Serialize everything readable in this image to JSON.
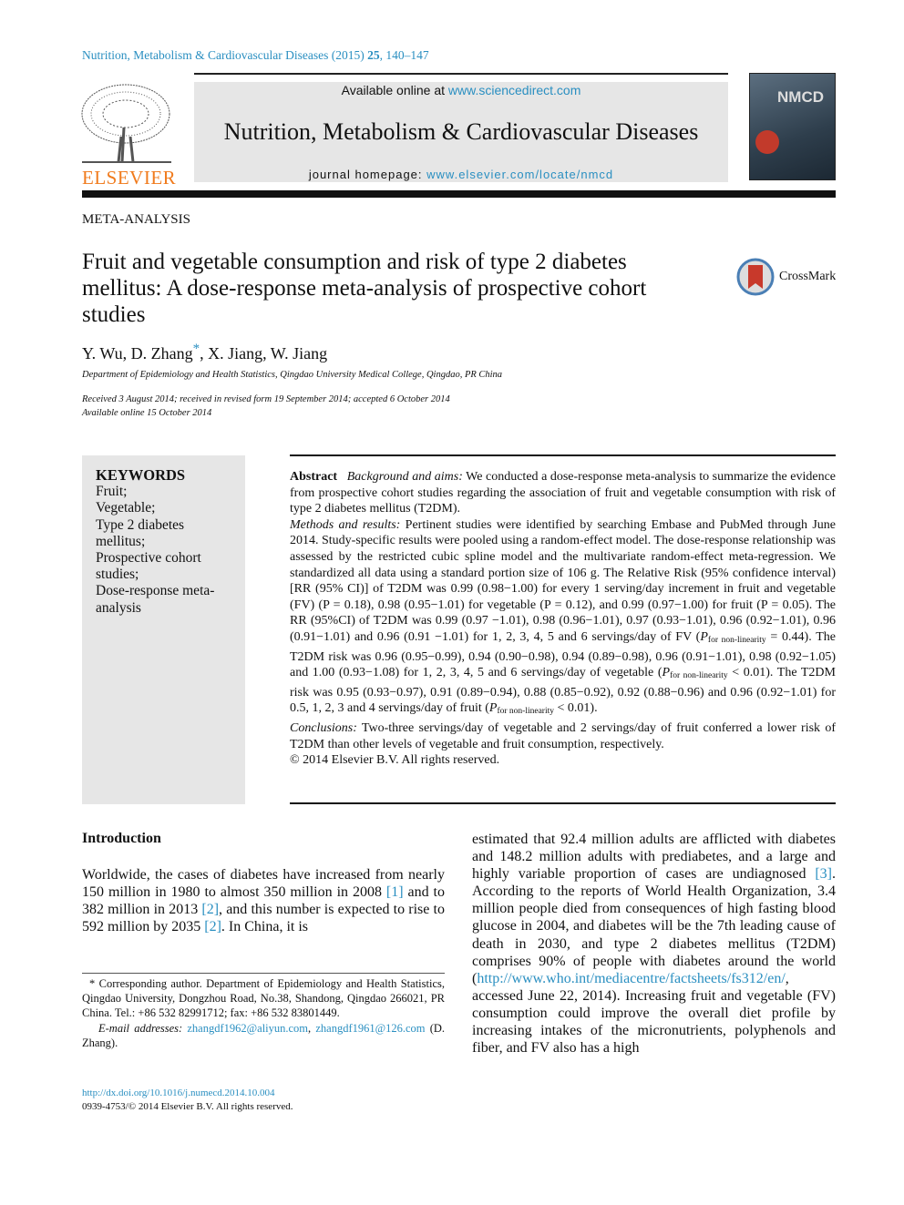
{
  "header": {
    "citation_journal": "Nutrition, Metabolism & Cardiovascular Diseases (2015) ",
    "citation_volume": "25",
    "citation_pages": ", 140–147",
    "publisher_logo": "ELSEVIER",
    "available_prefix": "Available online at ",
    "available_link": "www.sciencedirect.com",
    "journal_title": "Nutrition, Metabolism & Cardiovascular Diseases",
    "homepage_prefix": "journal homepage: ",
    "homepage_link": "www.elsevier.com/locate/nmcd",
    "cover_text": "NMCD",
    "colors": {
      "link": "#2a8fc1",
      "elsevier": "#f07b1d",
      "banner": "#e6e6e6"
    }
  },
  "article": {
    "section": "META-ANALYSIS",
    "title": "Fruit and vegetable consumption and risk of type 2 diabetes mellitus: A dose-response meta-analysis of prospective cohort studies",
    "crossmark": "CrossMark",
    "authors_a": "Y. Wu, D. Zhang",
    "authors_star": "*",
    "authors_b": ", X. Jiang, W. Jiang",
    "affiliation": "Department of Epidemiology and Health Statistics, Qingdao University Medical College, Qingdao, PR China",
    "received": "Received 3 August 2014; received in revised form 19 September 2014; accepted 6 October 2014",
    "available": "Available online 15 October 2014"
  },
  "keywords": {
    "heading": "KEYWORDS",
    "items": [
      "Fruit;",
      "Vegetable;",
      "Type 2 diabetes mellitus;",
      "Prospective cohort studies;",
      "Dose-response meta-analysis"
    ]
  },
  "abstract": {
    "label": "Abstract",
    "bg_label": "Background and aims:",
    "bg_text": " We conducted a dose-response meta-analysis to summarize the evidence from prospective cohort studies regarding the association of fruit and vegetable consumption with risk of type 2 diabetes mellitus (T2DM).",
    "mr_label": "Methods and results:",
    "mr_1": " Pertinent studies were identified by searching Embase and PubMed through June 2014. Study-specific results were pooled using a random-effect model. The dose-response relationship was assessed by the restricted cubic spline model and the multivariate random-effect meta-regression. We standardized all data using a standard portion size of 106 g. The Relative Risk (95% confidence interval) [RR (95% CI)] of T2DM was 0.99 (0.98−1.00) for every 1 serving/day increment in fruit and vegetable (FV) (P = 0.18), 0.98 (0.95−1.01) for vegetable (P = 0.12), and 0.99 (0.97−1.00) for fruit (P = 0.05). The RR (95%CI) of T2DM was 0.99 (0.97 −1.01), 0.98 (0.96−1.01), 0.97 (0.93−1.01), 0.96 (0.92−1.01), 0.96 (0.91−1.01) and 0.96 (0.91 −1.01) for 1, 2, 3, 4, 5 and 6 servings/day of FV (",
    "p": "P",
    "sub": "for non-linearity",
    "mr_2": " = 0.44). The T2DM risk was 0.96 (0.95−0.99), 0.94 (0.90−0.98), 0.94 (0.89−0.98), 0.96 (0.91−1.01), 0.98 (0.92−1.05) and 1.00 (0.93−1.08) for 1, 2, 3, 4, 5 and 6 servings/day of vegetable (",
    "mr_3": " < 0.01). The T2DM risk was 0.95 (0.93−0.97), 0.91 (0.89−0.94), 0.88 (0.85−0.92), 0.92 (0.88−0.96) and 0.96 (0.92−1.01) for 0.5, 1, 2, 3 and 4 servings/day of fruit (",
    "mr_4": " < 0.01).",
    "c_label": "Conclusions:",
    "c_text": " Two-three servings/day of vegetable and 2 servings/day of fruit conferred a lower risk of T2DM than other levels of vegetable and fruit consumption, respectively.",
    "copyright": "© 2014 Elsevier B.V. All rights reserved."
  },
  "intro": {
    "heading": "Introduction",
    "l1": "Worldwide, the cases of diabetes have increased from nearly 150 million in 1980 to almost 350 million in 2008 ",
    "ref1": "[1]",
    "l2": " and to 382 million in 2013 ",
    "ref2": "[2]",
    "l3": ", and this number is expected to rise to 592 million by 2035 ",
    "ref3": "[2]",
    "l4": ". In China, it is",
    "r1": "estimated that 92.4 million adults are afflicted with diabetes and 148.2 million adults with prediabetes, and a large and highly variable proportion of cases are undiagnosed ",
    "ref4": "[3]",
    "r2": ". According to the reports of World Health Organization, 3.4 million people died from consequences of high fasting blood glucose in 2004, and diabetes will be the 7th leading cause of death in 2030, and type 2 diabetes mellitus (T2DM) comprises 90% of people with diabetes around the world (",
    "who_link": "http://www.who.int/mediacentre/factsheets/fs312/en/",
    "r3": ", accessed June 22, 2014). Increasing fruit and vegetable (FV) consumption could improve the overall diet profile by increasing intakes of the micronutrients, polyphenols and fiber, and FV also has a high"
  },
  "footnote": {
    "corresponding": "* Corresponding author. Department of Epidemiology and Health Statistics, Qingdao University, Dongzhou Road, No.38, Shandong, Qingdao 266021, PR China. Tel.: +86 532 82991712; fax: +86 532 83801449.",
    "email_label": "E-mail addresses:",
    "email1": "zhangdf1962@aliyun.com",
    "email2": "zhangdf1961@126.com",
    "email_name": "(D. Zhang).",
    "doi": "http://dx.doi.org/10.1016/j.numecd.2014.10.004",
    "issn": "0939-4753/© 2014 Elsevier B.V. All rights reserved."
  }
}
